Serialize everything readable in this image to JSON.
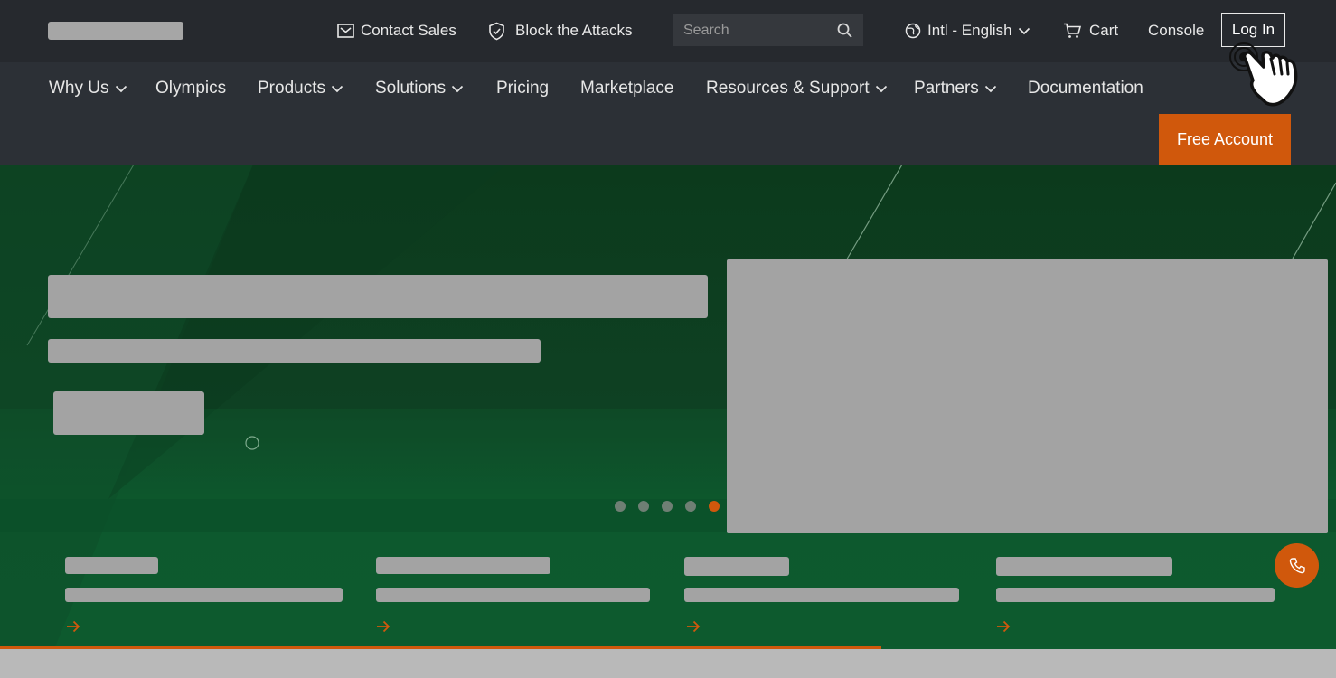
{
  "header": {
    "contact_sales": "Contact Sales",
    "block_attacks": "Block the Attacks",
    "search_placeholder": "Search",
    "language": "Intl - English",
    "cart": "Cart",
    "console": "Console",
    "login": "Log In"
  },
  "nav": {
    "items": [
      {
        "label": "Why Us",
        "dropdown": true
      },
      {
        "label": "Olympics",
        "dropdown": false
      },
      {
        "label": "Products",
        "dropdown": true
      },
      {
        "label": "Solutions",
        "dropdown": true
      },
      {
        "label": "Pricing",
        "dropdown": false
      },
      {
        "label": "Marketplace",
        "dropdown": false
      },
      {
        "label": "Resources & Support",
        "dropdown": true
      },
      {
        "label": "Partners",
        "dropdown": true
      },
      {
        "label": "Documentation",
        "dropdown": false
      }
    ],
    "free_account": "Free Account"
  },
  "carousel": {
    "slide_count": 5,
    "active_slide": 5,
    "progress_fraction": 0.66
  },
  "icons": {
    "contact": "mail-icon",
    "block": "shield-check-icon",
    "search": "search-icon",
    "language": "globe-icon",
    "cart": "cart-icon",
    "chevron": "chevron-down-icon",
    "arrow": "arrow-right-icon",
    "phone": "phone-icon",
    "cursor": "hand-pointer-icon"
  },
  "colors": {
    "accent": "#d0580c",
    "header_bg": "#26292e",
    "nav_bg": "#2c3036",
    "hero_green": "#0d5b2f"
  }
}
